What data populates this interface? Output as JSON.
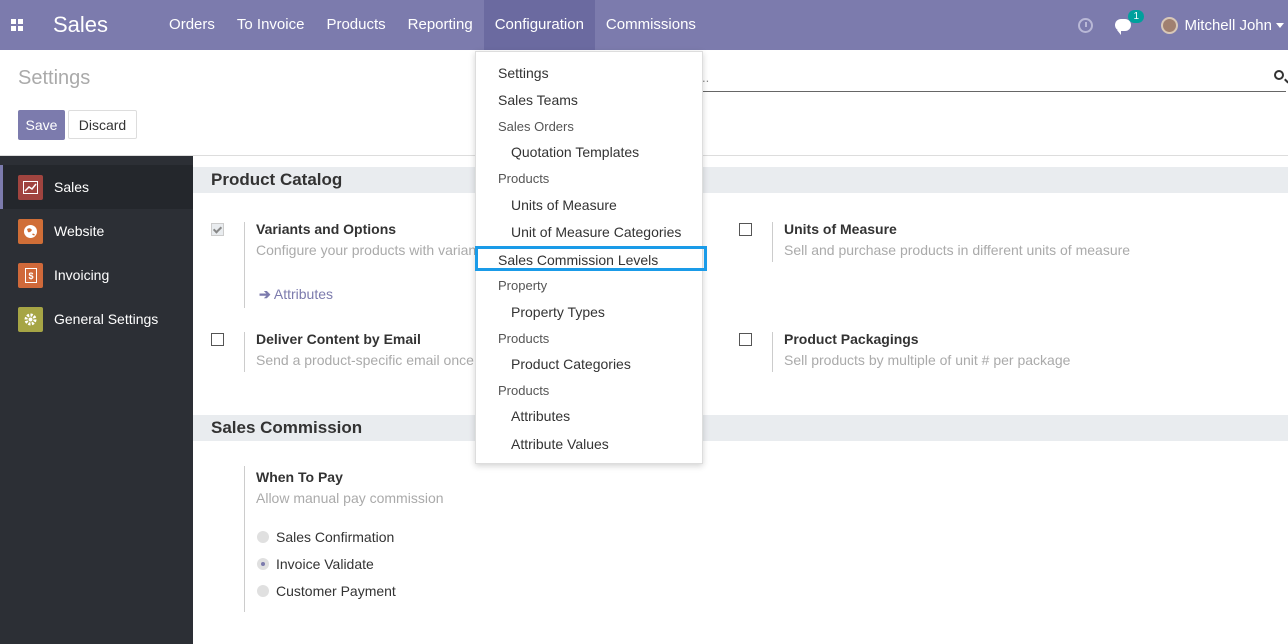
{
  "navbar": {
    "brand": "Sales",
    "menu": [
      "Orders",
      "To Invoice",
      "Products",
      "Reporting",
      "Configuration",
      "Commissions"
    ],
    "active_menu": "Configuration",
    "chat_badge": "1",
    "user_name": "Mitchell John"
  },
  "control": {
    "title": "Settings",
    "save_label": "Save",
    "discard_label": "Discard",
    "search_value": ".."
  },
  "sidebar": {
    "items": [
      {
        "label": "Sales",
        "color": "#a0443f",
        "icon": "chart-icon"
      },
      {
        "label": "Website",
        "color": "#d06e37",
        "icon": "globe-icon"
      },
      {
        "label": "Invoicing",
        "color": "#d0693a",
        "icon": "invoice-icon"
      },
      {
        "label": "General Settings",
        "color": "#a6a545",
        "icon": "gear-icon"
      }
    ]
  },
  "sections": {
    "catalog": {
      "title": "Product Catalog",
      "variants_title": "Variants and Options",
      "variants_desc": "Configure your products with varian",
      "attributes_link": "Attributes",
      "uom_title": "Units of Measure",
      "uom_desc": "Sell and purchase products in different units of measure",
      "deliver_title": "Deliver Content by Email",
      "deliver_desc": "Send a product-specific email once",
      "packaging_title": "Product Packagings",
      "packaging_desc": "Sell products by multiple of unit # per package"
    },
    "commission": {
      "title": "Sales Commission",
      "when_title": "When To Pay",
      "when_desc": "Allow manual pay commission",
      "options": [
        "Sales Confirmation",
        "Invoice Validate",
        "Customer Payment"
      ],
      "selected": "Invoice Validate"
    }
  },
  "dropdown": {
    "settings": "Settings",
    "sales_teams": "Sales Teams",
    "h_sales_orders": "Sales Orders",
    "quotation_templates": "Quotation Templates",
    "h_products_1": "Products",
    "units_of_measure": "Units of Measure",
    "uom_categories": "Unit of Measure Categories",
    "sales_commission_levels": "Sales Commission Levels",
    "h_property": "Property",
    "property_types": "Property Types",
    "h_products_2": "Products",
    "product_categories": "Product Categories",
    "h_products_3": "Products",
    "attributes": "Attributes",
    "attribute_values": "Attribute Values"
  }
}
